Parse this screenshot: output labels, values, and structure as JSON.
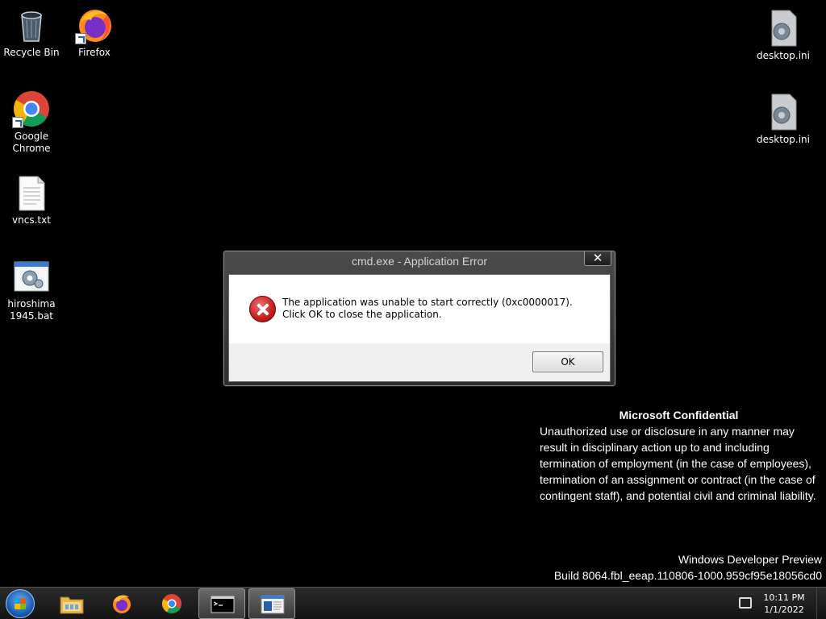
{
  "desktop": {
    "icons_left": [
      {
        "label": "Recycle Bin",
        "icon": "recycle-bin-icon"
      },
      {
        "label": "Firefox",
        "icon": "firefox-icon"
      },
      {
        "label": "Google Chrome",
        "icon": "chrome-icon"
      },
      {
        "label": "vncs.txt",
        "icon": "text-file-icon"
      },
      {
        "label": "hiroshima 1945.bat",
        "icon": "batch-file-icon"
      }
    ],
    "icons_right": [
      {
        "label": "desktop.ini",
        "icon": "settings-file-icon"
      },
      {
        "label": "desktop.ini",
        "icon": "settings-file-icon"
      }
    ]
  },
  "dialog": {
    "title": "cmd.exe - Application Error",
    "close_label": "✕",
    "message": "The application was unable to start correctly (0xc0000017). Click OK to close the application.",
    "ok_label": "OK"
  },
  "watermark": {
    "title": "Microsoft Confidential",
    "body": "Unauthorized use or disclosure in any manner may result in disciplinary action up to and including termination of employment (in the case of employees), termination of an assignment or contract (in the case of contingent staff), and potential civil and criminal liability.",
    "edition": "Windows Developer Preview",
    "build": "Build 8064.fbl_eeap.110806-1000.959cf95e18056cd0"
  },
  "taskbar": {
    "items": [
      {
        "icon": "file-explorer-icon"
      },
      {
        "icon": "firefox-icon"
      },
      {
        "icon": "chrome-icon"
      },
      {
        "icon": "command-prompt-icon"
      },
      {
        "icon": "window-app-icon"
      }
    ],
    "clock": {
      "time": "10:11 PM",
      "date": "1/1/2022"
    }
  }
}
